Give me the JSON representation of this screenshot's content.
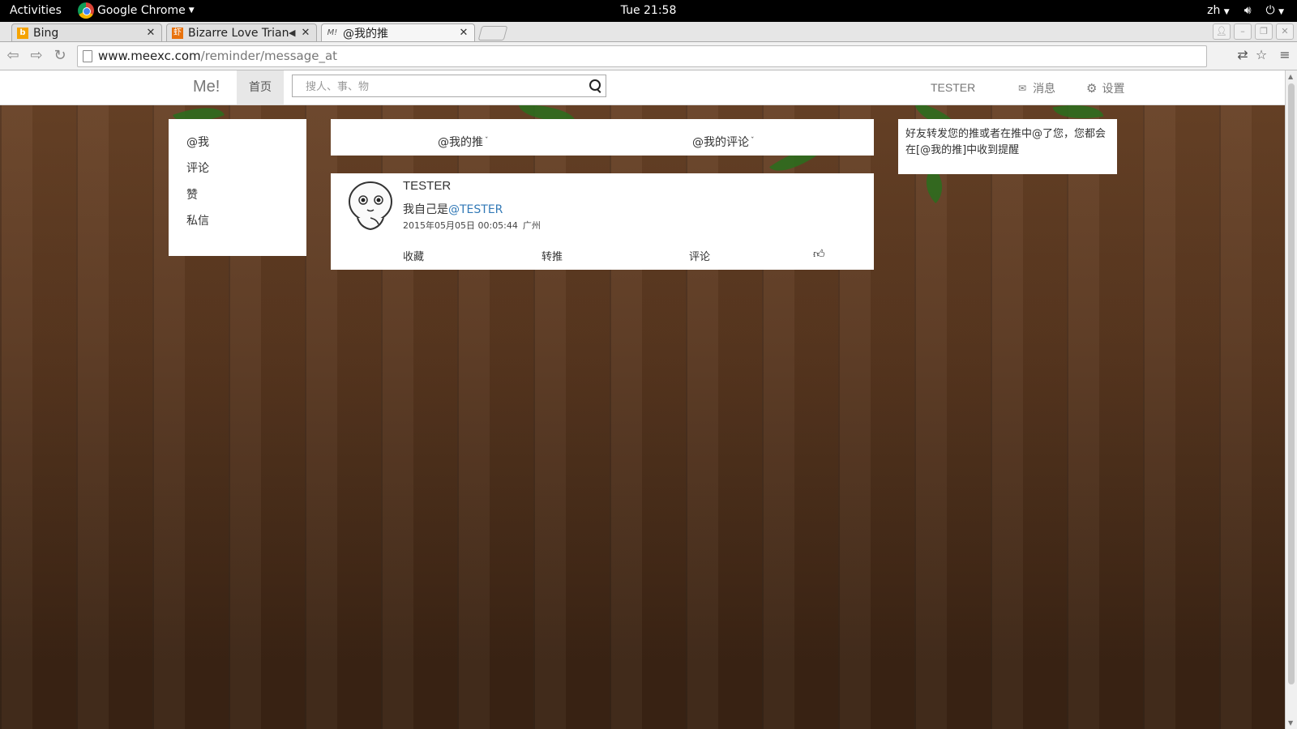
{
  "gnome": {
    "activities": "Activities",
    "app_name": "Google Chrome",
    "clock": "Tue 21:58",
    "lang": "zh",
    "volume_icon": "volume-icon",
    "power_icon": "power-icon"
  },
  "browser": {
    "tabs": [
      {
        "title": "Bing",
        "favicon": "bing-icon"
      },
      {
        "title": "Bizarre Love Trian",
        "favicon": "music-site-icon",
        "audio_icon": "speaker-icon"
      },
      {
        "title": "@我的推",
        "favicon": "meexc-icon"
      }
    ],
    "url_host": "www.meexc.com",
    "url_path": "/reminder/message_at"
  },
  "site": {
    "brand": "Me!",
    "nav_home": "首页",
    "search_placeholder": "搜人、事、物",
    "user": "TESTER",
    "messages": "消息",
    "settings": "设置",
    "side_menu": [
      {
        "label": "@我"
      },
      {
        "label": "评论"
      },
      {
        "label": "赞"
      },
      {
        "label": "私信"
      }
    ],
    "tabs": {
      "my_posts": "@我的推",
      "my_comments": "@我的评论"
    },
    "post": {
      "user": "TESTER",
      "text": "我自己是",
      "mention": "@TESTER",
      "time": "2015年05月05日 00:05:44",
      "location": "广州",
      "actions": {
        "favorite": "收藏",
        "repost": "转推",
        "comment": "评论"
      },
      "like_icon": "thumbs-up-icon"
    },
    "tip": "好友转发您的推或者在推中@了您，您都会在[@我的推]中收到提醒"
  }
}
